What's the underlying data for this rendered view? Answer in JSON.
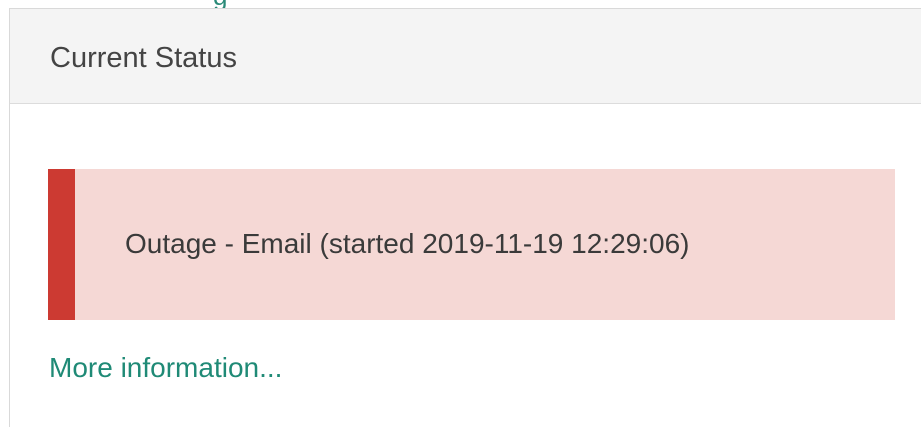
{
  "panel": {
    "title": "Current Status"
  },
  "alert": {
    "message": "Outage - Email (started 2019-11-19 12:29:06)",
    "accent_color": "#cc3a32",
    "background_color": "#f5d8d5"
  },
  "link": {
    "more_info_label": "More information..."
  }
}
